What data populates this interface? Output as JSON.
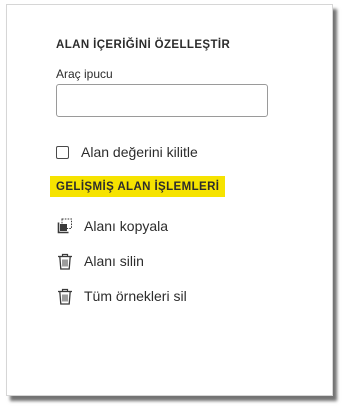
{
  "panel": {
    "section_title": "ALAN İÇERİĞİNİ ÖZELLEŞTİR",
    "tooltip": {
      "label": "Araç ipucu",
      "value": "",
      "placeholder": ""
    },
    "lock_field": {
      "label": "Alan değerini kilitle",
      "checked": false
    },
    "advanced": {
      "title": "GELİŞMİŞ ALAN İŞLEMLERİ",
      "highlight_color": "#f6e300",
      "actions": [
        {
          "label": "Alanı kopyala",
          "icon": "copy-field-icon"
        },
        {
          "label": "Alanı silin",
          "icon": "trash-icon"
        },
        {
          "label": "Tüm örnekleri sil",
          "icon": "trash-icon"
        }
      ]
    }
  }
}
